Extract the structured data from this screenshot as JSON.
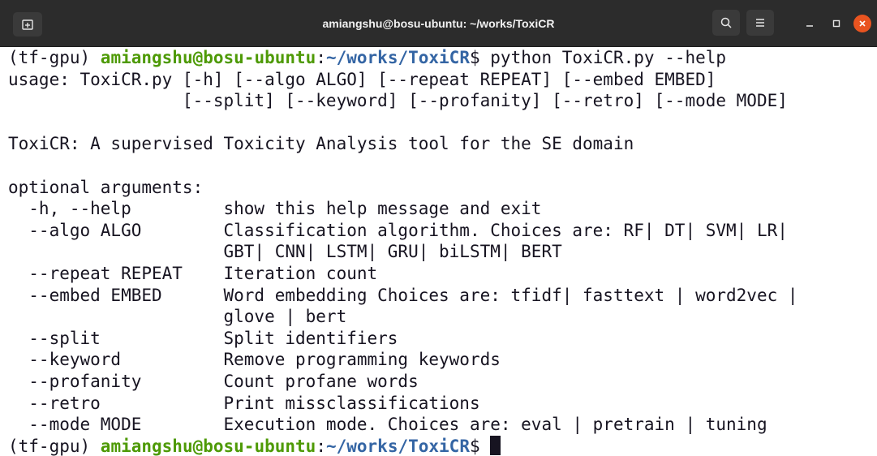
{
  "window": {
    "title": "amiangshu@bosu-ubuntu: ~/works/ToxiCR"
  },
  "icons": {
    "new_tab": "new-tab-icon",
    "search": "search-icon",
    "menu": "hamburger-menu-icon",
    "minimize": "minimize-icon",
    "maximize": "maximize-icon",
    "close": "close-icon"
  },
  "colors": {
    "prompt_user_host": "#4e9a06",
    "prompt_path": "#3465a4",
    "close_button": "#e95420",
    "titlebar": "#2c2c2c"
  },
  "terminal": {
    "prompt1": {
      "env": "(tf-gpu) ",
      "user_host": "amiangshu@bosu-ubuntu",
      "colon": ":",
      "path": "~/works/ToxiCR",
      "symbol": "$ ",
      "command": "python ToxiCR.py --help"
    },
    "output_lines": [
      "usage: ToxiCR.py [-h] [--algo ALGO] [--repeat REPEAT] [--embed EMBED]",
      "                 [--split] [--keyword] [--profanity] [--retro] [--mode MODE]",
      "",
      "ToxiCR: A supervised Toxicity Analysis tool for the SE domain",
      "",
      "optional arguments:",
      "  -h, --help         show this help message and exit",
      "  --algo ALGO        Classification algorithm. Choices are: RF| DT| SVM| LR|",
      "                     GBT| CNN| LSTM| GRU| biLSTM| BERT",
      "  --repeat REPEAT    Iteration count",
      "  --embed EMBED      Word embedding Choices are: tfidf| fasttext | word2vec |",
      "                     glove | bert",
      "  --split            Split identifiers",
      "  --keyword          Remove programming keywords",
      "  --profanity        Count profane words",
      "  --retro            Print missclassifications",
      "  --mode MODE        Execution mode. Choices are: eval | pretrain | tuning"
    ],
    "prompt2": {
      "env": "(tf-gpu) ",
      "user_host": "amiangshu@bosu-ubuntu",
      "colon": ":",
      "path": "~/works/ToxiCR",
      "symbol": "$ ",
      "command": ""
    }
  }
}
